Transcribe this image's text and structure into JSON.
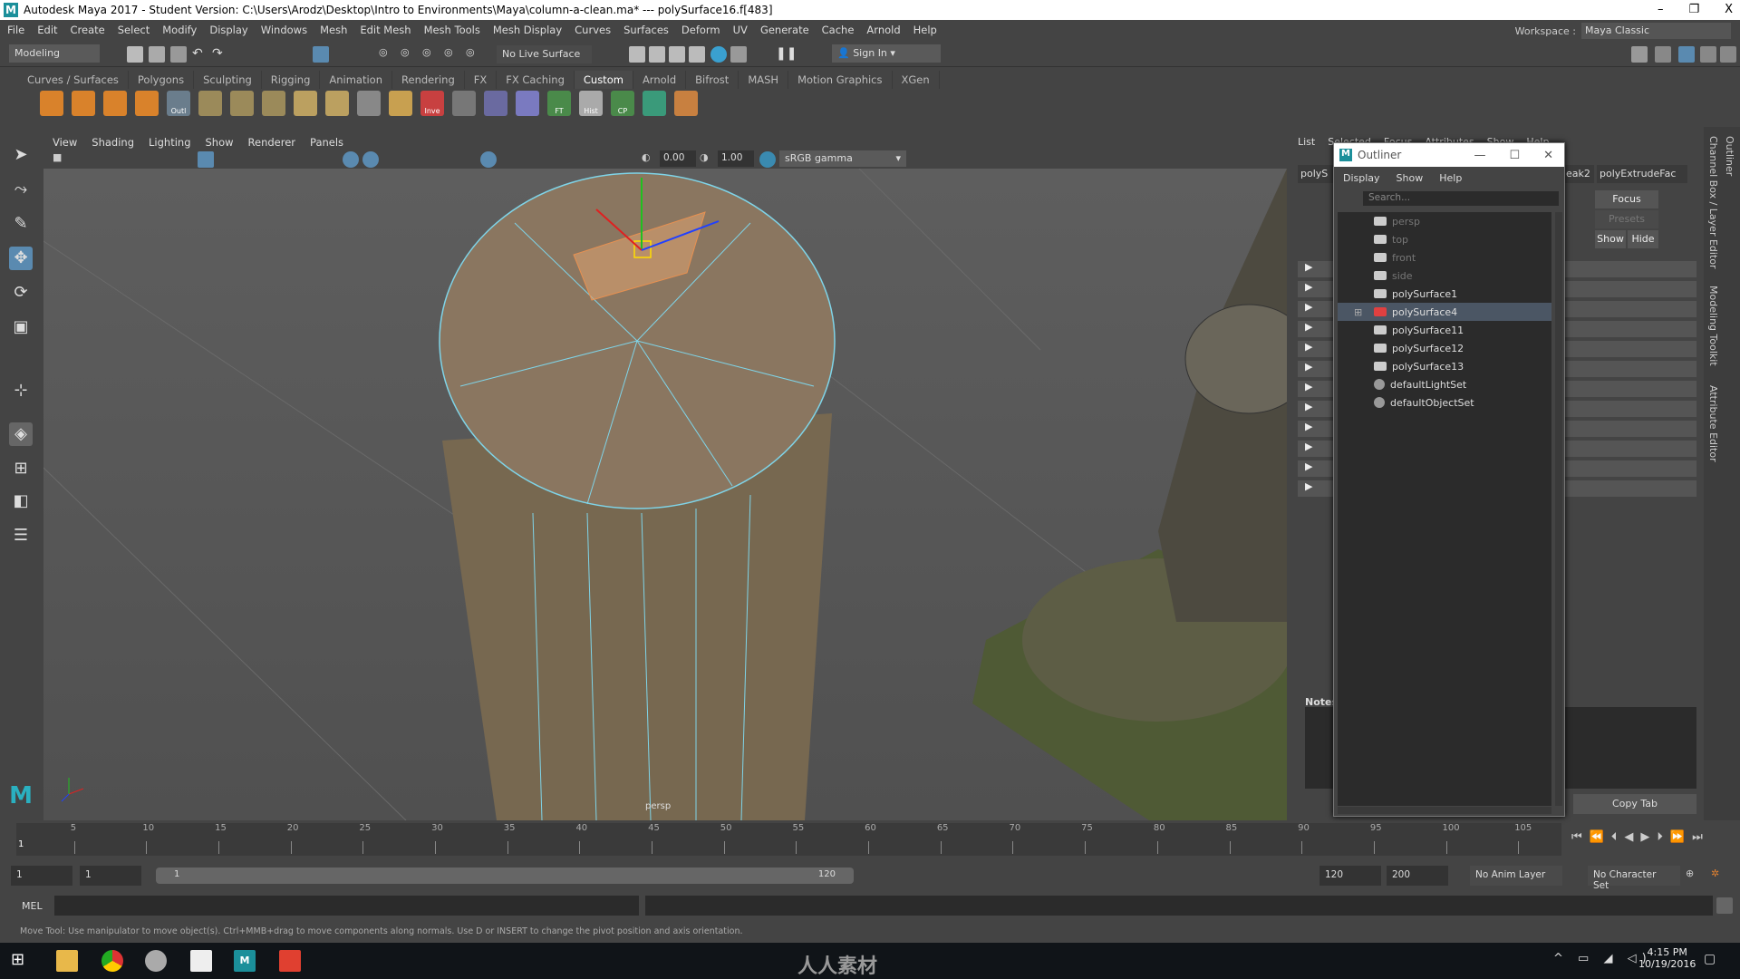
{
  "title": "Autodesk Maya 2017 - Student Version: C:\\Users\\Arodz\\Desktop\\Intro to Environments\\Maya\\column-a-clean.ma*  ---  polySurface16.f[483]",
  "window_controls": [
    "–",
    "❐",
    "X"
  ],
  "menubar": [
    "File",
    "Edit",
    "Create",
    "Select",
    "Modify",
    "Display",
    "Windows",
    "Mesh",
    "Edit Mesh",
    "Mesh Tools",
    "Mesh Display",
    "Curves",
    "Surfaces",
    "Deform",
    "UV",
    "Generate",
    "Cache",
    "Arnold",
    "Help"
  ],
  "workspace": {
    "label": "Workspace :",
    "value": "Maya Classic"
  },
  "statusline": {
    "mode": "Modeling",
    "live_surface": "No Live Surface",
    "sign_in": "Sign In"
  },
  "shelf_tabs": [
    "Curves / Surfaces",
    "Polygons",
    "Sculpting",
    "Rigging",
    "Animation",
    "Rendering",
    "FX",
    "FX Caching",
    "Custom",
    "Arnold",
    "Bifrost",
    "MASH",
    "Motion Graphics",
    "XGen"
  ],
  "shelf_active": "Custom",
  "shelf_icons": [
    {
      "label": "",
      "color": "#d9822b"
    },
    {
      "label": "",
      "color": "#d9822b"
    },
    {
      "label": "",
      "color": "#d9822b"
    },
    {
      "label": "",
      "color": "#d9822b"
    },
    {
      "label": "Outl",
      "color": "#6a7d8c"
    },
    {
      "label": "",
      "color": "#9b8a5a"
    },
    {
      "label": "",
      "color": "#9b8a5a"
    },
    {
      "label": "",
      "color": "#9b8a5a"
    },
    {
      "label": "",
      "color": "#bba060"
    },
    {
      "label": "",
      "color": "#bba060"
    },
    {
      "label": "",
      "color": "#888"
    },
    {
      "label": "",
      "color": "#c8a050"
    },
    {
      "label": "Inve",
      "color": "#c84040"
    },
    {
      "label": "",
      "color": "#777"
    },
    {
      "label": "",
      "color": "#6a6aa0"
    },
    {
      "label": "",
      "color": "#7a7ac0"
    },
    {
      "label": "FT",
      "color": "#4a8a4a"
    },
    {
      "label": "Hist",
      "color": "#aaaaaa"
    },
    {
      "label": "CP",
      "color": "#4a8a4a"
    },
    {
      "label": "",
      "color": "#3a9a7a"
    },
    {
      "label": "",
      "color": "#c88040"
    }
  ],
  "viewport": {
    "menus": [
      "View",
      "Shading",
      "Lighting",
      "Show",
      "Renderer",
      "Panels"
    ],
    "exposure": "0.00",
    "gamma": "1.00",
    "color_space": "sRGB gamma",
    "camera_label": "persp"
  },
  "channelbox": {
    "menus": [
      "List",
      "Selected",
      "Focus",
      "Attributes",
      "Show",
      "Help"
    ],
    "tabs": [
      "polyS",
      "eak2",
      "polyExtrudeFac"
    ],
    "focus": "Focus",
    "presets": "Presets",
    "show": "Show",
    "hide": "Hide",
    "notes": "Notes",
    "copy_tab": "Copy Tab"
  },
  "side_tabs": [
    "Channel Box / Layer Editor",
    "Modeling Toolkit",
    "Attribute Editor",
    "Outliner"
  ],
  "outliner": {
    "title": "Outliner",
    "menus": [
      "Display",
      "Show",
      "Help"
    ],
    "search_placeholder": "Search...",
    "items": [
      {
        "name": "persp",
        "icon": "camera-icon",
        "dim": true
      },
      {
        "name": "top",
        "icon": "camera-icon",
        "dim": true
      },
      {
        "name": "front",
        "icon": "camera-icon",
        "dim": true
      },
      {
        "name": "side",
        "icon": "camera-icon",
        "dim": true
      },
      {
        "name": "polySurface1",
        "icon": "mesh-icon"
      },
      {
        "name": "polySurface4",
        "icon": "mesh-icon",
        "selected": true,
        "expandable": true
      },
      {
        "name": "polySurface11",
        "icon": "mesh-icon"
      },
      {
        "name": "polySurface12",
        "icon": "mesh-icon"
      },
      {
        "name": "polySurface13",
        "icon": "mesh-icon"
      },
      {
        "name": "defaultLightSet",
        "icon": "set-icon"
      },
      {
        "name": "defaultObjectSet",
        "icon": "set-icon"
      }
    ]
  },
  "timeline": {
    "ticks": [
      5,
      10,
      15,
      20,
      25,
      30,
      35,
      40,
      45,
      50,
      55,
      60,
      65,
      70,
      75,
      80,
      85,
      90,
      95,
      100,
      105
    ],
    "current": "1"
  },
  "range": {
    "start": "1",
    "anim_start": "1",
    "range_start": "1",
    "range_end": "120",
    "end": "120",
    "anim_end": "200",
    "anim_layer": "No Anim Layer",
    "character_set": "No Character Set"
  },
  "cmdline": {
    "label": "MEL"
  },
  "helpline": "Move Tool: Use manipulator to move object(s). Ctrl+MMB+drag to move components along normals. Use D or INSERT to change the pivot position and axis orientation.",
  "taskbar": {
    "time": "4:15 PM",
    "date": "10/19/2016"
  },
  "watermark": "人人素材"
}
